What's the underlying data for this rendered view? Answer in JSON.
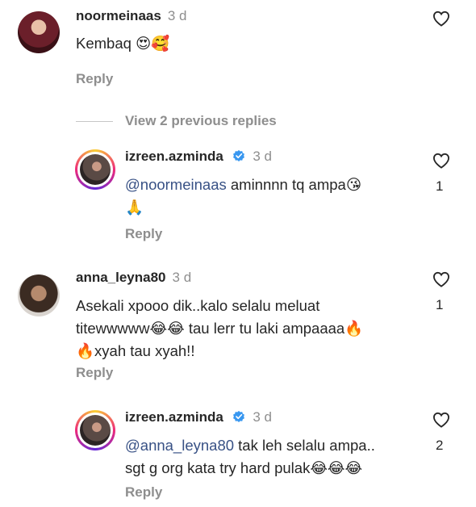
{
  "comments": [
    {
      "username": "noormeinaas",
      "time": "3 d",
      "text": "Kembaq 😍🥰",
      "reply_label": "Reply"
    },
    {
      "username": "anna_leyna80",
      "time": "3 d",
      "line1": "Asekali xpooo dik..kalo selalu meluat",
      "line2": "titewwwww😂😂 tau lerr tu laki ampaaaa🔥",
      "line3": "🔥xyah tau xyah!!",
      "likes": "1",
      "reply_label": "Reply"
    }
  ],
  "view_replies": "View 2 previous replies",
  "replies": [
    {
      "username": "izreen.azminda",
      "time": "3 d",
      "mention": "@noormeinaas",
      "line1_rest": " aminnnn tq ampa😘",
      "line2": "🙏",
      "likes": "1",
      "reply_label": "Reply"
    },
    {
      "username": "izreen.azminda",
      "time": "3 d",
      "mention": "@anna_leyna80",
      "line1_rest": " tak leh selalu ampa..",
      "line2": "sgt g org kata try hard pulak😂😂😂",
      "likes": "2",
      "reply_label": "Reply"
    }
  ],
  "colors": {
    "verified": "#3897f0",
    "mention": "#385185",
    "secondary": "#8e8e8e"
  },
  "icons": {
    "like": "heart-outline-icon",
    "verified": "verified-badge-icon"
  }
}
